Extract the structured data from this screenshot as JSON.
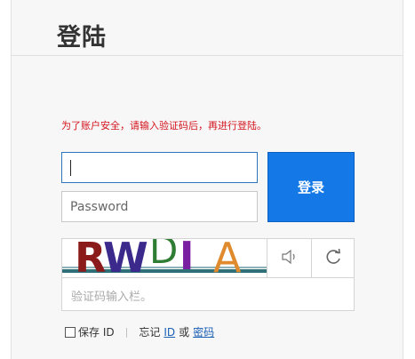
{
  "header": {
    "title": "登陆"
  },
  "warning": "为了账户安全，请输入验证码后，再进行登陆。",
  "form": {
    "id_value": "",
    "password_placeholder": "Password",
    "login_label": "登录",
    "captcha_text": "RWDIA",
    "captcha_placeholder": "验证码输入栏。",
    "audio_icon": "speaker-icon",
    "refresh_icon": "refresh-icon"
  },
  "footer": {
    "save_id_label": "保存 ID",
    "separator": "|",
    "forgot_label": "忘记",
    "id_link": "ID",
    "or": "或",
    "password_link": "密码"
  },
  "colors": {
    "accent": "#1479e6",
    "warning": "#d4141e",
    "link": "#1a5fb4"
  }
}
